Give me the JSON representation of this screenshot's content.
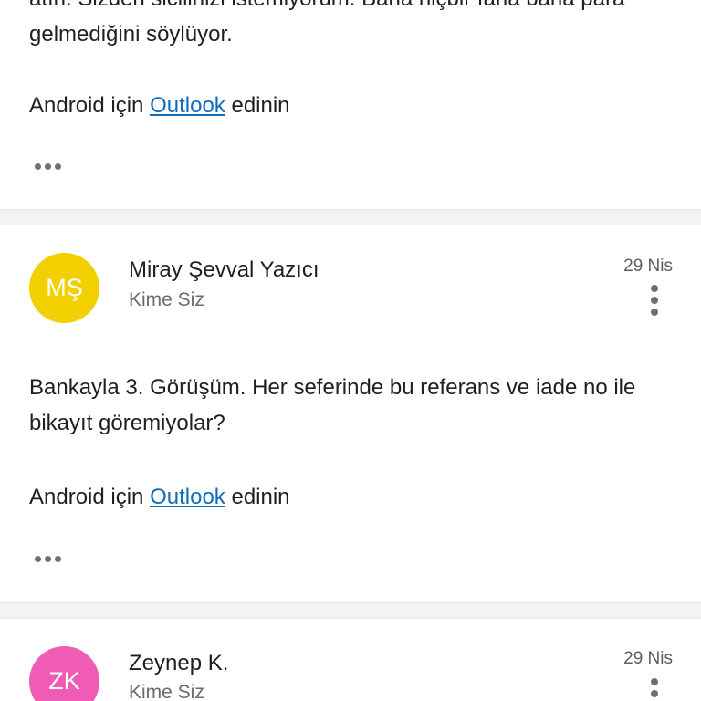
{
  "messages": [
    {
      "body_lines": [
        "atın. Sizden sicilinizi istemiyorum. Bana hiçbir farla bana para",
        "gelmediğini söylüyor."
      ],
      "footer_prefix": "Android için",
      "footer_link": "Outlook",
      "footer_suffix": "edinin"
    },
    {
      "avatar_initials": "MŞ",
      "avatar_color": "#f2d000",
      "sender": "Miray Şevval Yazıcı",
      "recipient": "Kime Siz",
      "date": "29 Nis",
      "body_lines": [
        "Bankayla 3. Görüşüm. Her seferinde bu referans ve iade no ile",
        "bikayıt göremiyolar?"
      ],
      "footer_prefix": "Android için",
      "footer_link": "Outlook",
      "footer_suffix": "edinin"
    },
    {
      "avatar_initials": "ZK",
      "avatar_color": "#ef5bb5",
      "sender": "Zeynep K.",
      "recipient": "Kime Siz",
      "date": "29 Nis"
    }
  ],
  "colors": {
    "link": "#0f6cbd",
    "separator": "#f3f3f3",
    "secondary_text": "#6b6b6b"
  },
  "icons": {
    "more": "more-horizontal-icon",
    "actions": "more-vertical-icon"
  }
}
